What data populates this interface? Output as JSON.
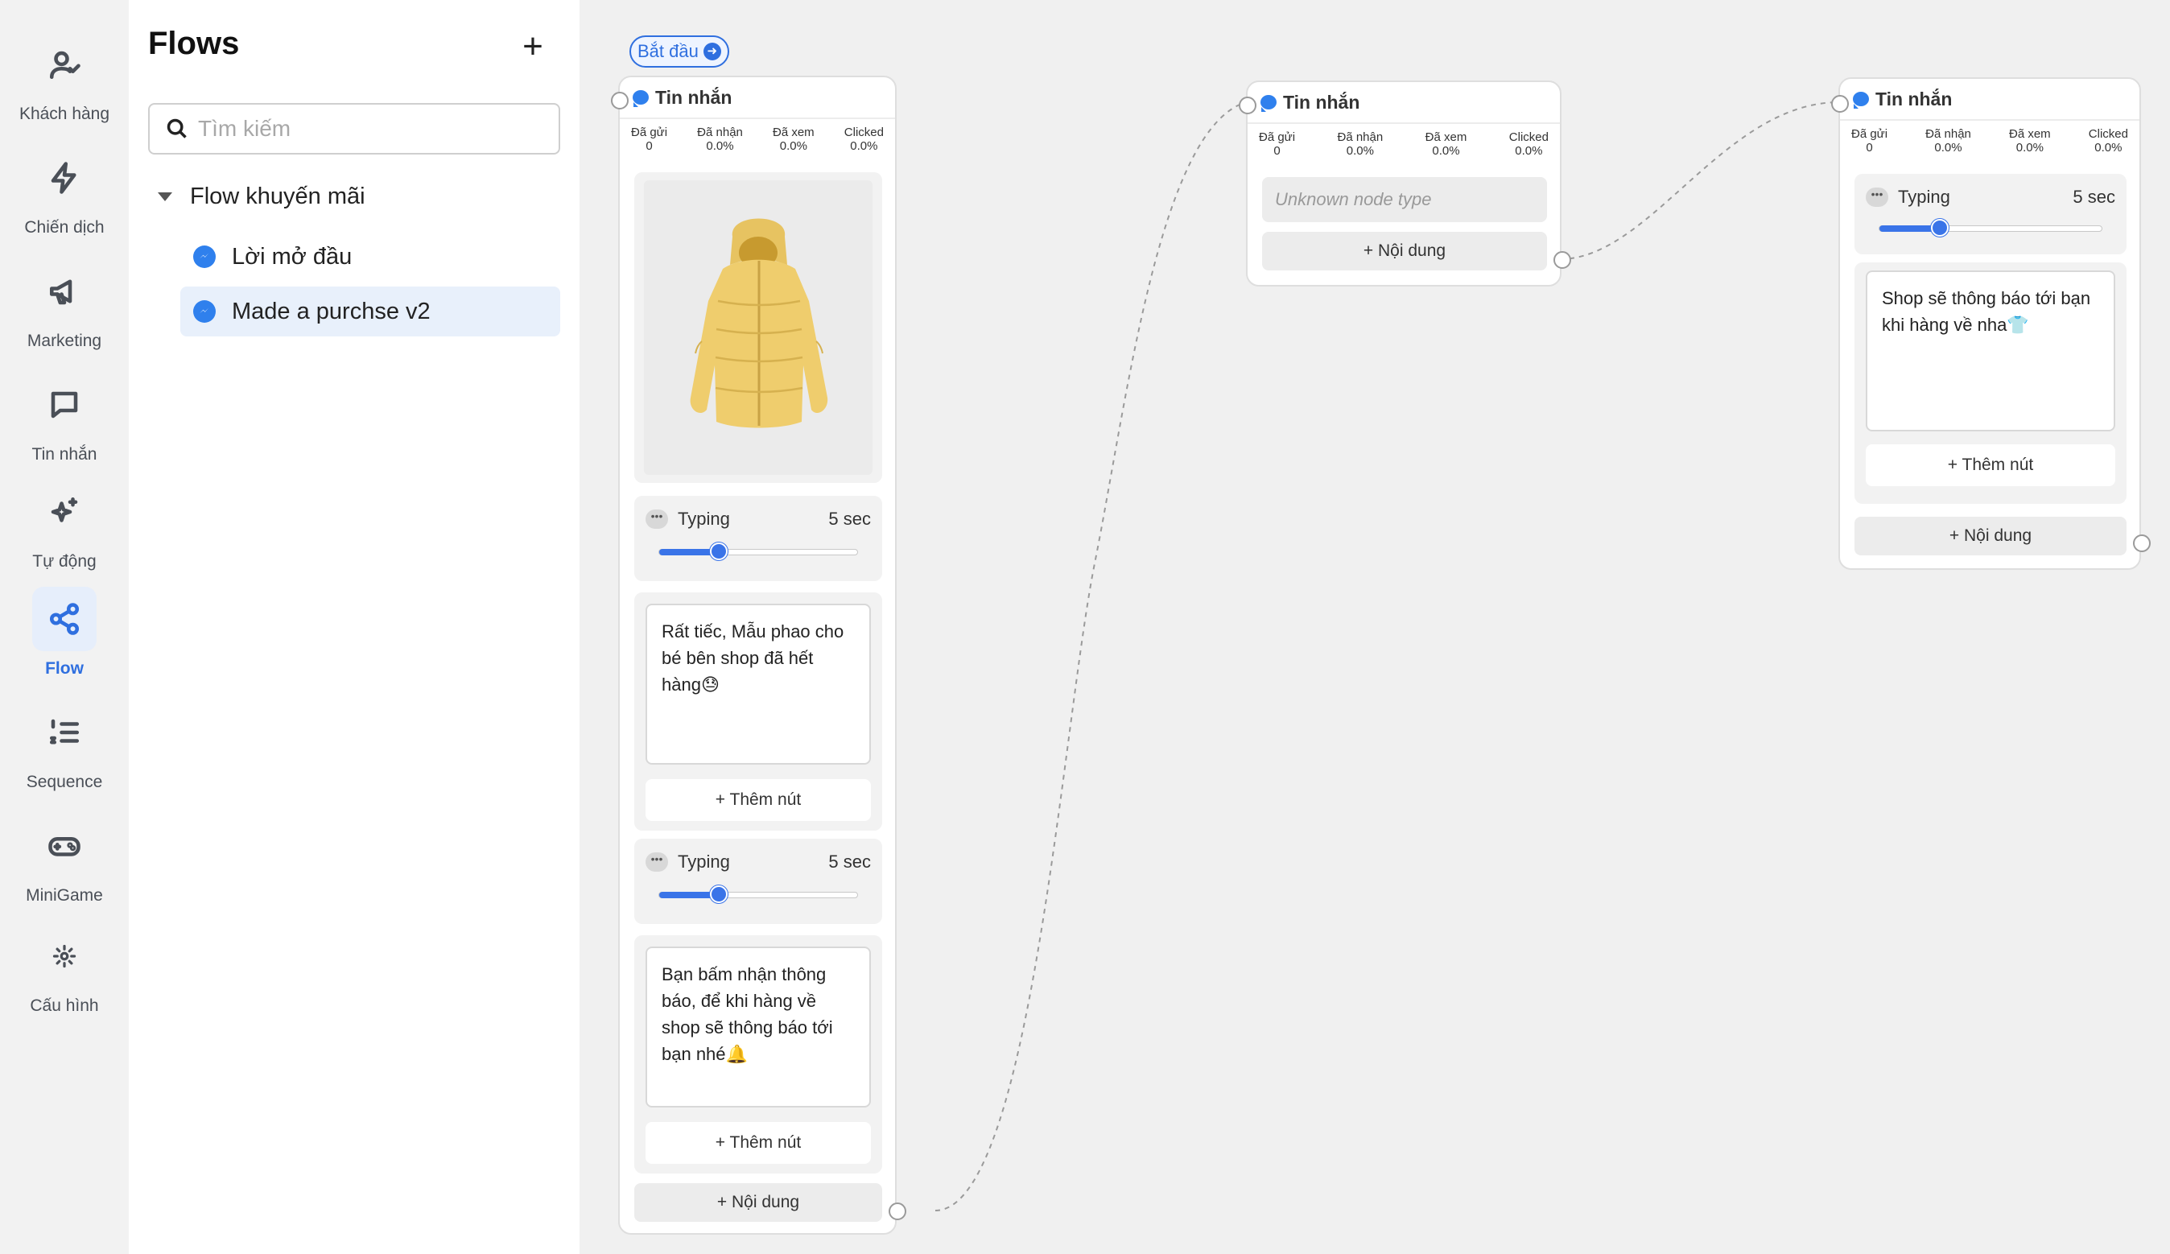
{
  "rail": [
    {
      "label": "Khách hàng",
      "icon": "user-check-icon"
    },
    {
      "label": "Chiến dịch",
      "icon": "lightning-icon"
    },
    {
      "label": "Marketing",
      "icon": "megaphone-icon"
    },
    {
      "label": "Tin nhắn",
      "icon": "chat-icon"
    },
    {
      "label": "Tự động",
      "icon": "sparkles-icon"
    },
    {
      "label": "Flow",
      "icon": "share-icon",
      "active": true
    },
    {
      "label": "Sequence",
      "icon": "numbered-list-icon"
    },
    {
      "label": "MiniGame",
      "icon": "gamepad-icon"
    },
    {
      "label": "Cấu hình",
      "icon": "gear-icon"
    }
  ],
  "panel": {
    "title": "Flows",
    "add": "+",
    "search_placeholder": "Tìm kiếm",
    "folder": "Flow khuyến mãi",
    "items": [
      {
        "label": "Lời mở đầu",
        "selected": false
      },
      {
        "label": "Made a purchse v2",
        "selected": true
      }
    ]
  },
  "canvas": {
    "start_label": "Bắt đầu",
    "stat_headers": [
      "Đã gửi",
      "Đã nhận",
      "Đã xem",
      "Clicked"
    ],
    "stat_values": [
      "0",
      "0.0%",
      "0.0%",
      "0.0%"
    ],
    "node1": {
      "title": "Tin nhắn",
      "image_alt": "yellow-jacket-image",
      "typing1": {
        "label": "Typing",
        "value": "5 sec",
        "level": 0.3
      },
      "text1": "Rất tiếc, Mẫu phao cho bé bên shop đã hết hàng😓",
      "add_button1": "+ Thêm nút",
      "typing2": {
        "label": "Typing",
        "value": "5 sec",
        "level": 0.3
      },
      "text2": "Bạn bấm nhận thông báo, để khi hàng về shop sẽ thông báo tới bạn nhé🔔",
      "add_button2": "+ Thêm nút",
      "add_content": "+ Nội dung"
    },
    "node2": {
      "title": "Tin nhắn",
      "unknown": "Unknown node type",
      "add_content": "+ Nội dung"
    },
    "node3": {
      "title": "Tin nhắn",
      "typing": {
        "label": "Typing",
        "value": "5 sec",
        "level": 0.27
      },
      "text": "Shop sẽ thông báo tới bạn khi hàng về nha👕",
      "add_button": "+ Thêm nút",
      "add_content": "+ Nội dung"
    }
  },
  "colors": {
    "accent": "#2f6fdf",
    "slider": "#3a74e8",
    "messenger": "#2f80ed"
  }
}
